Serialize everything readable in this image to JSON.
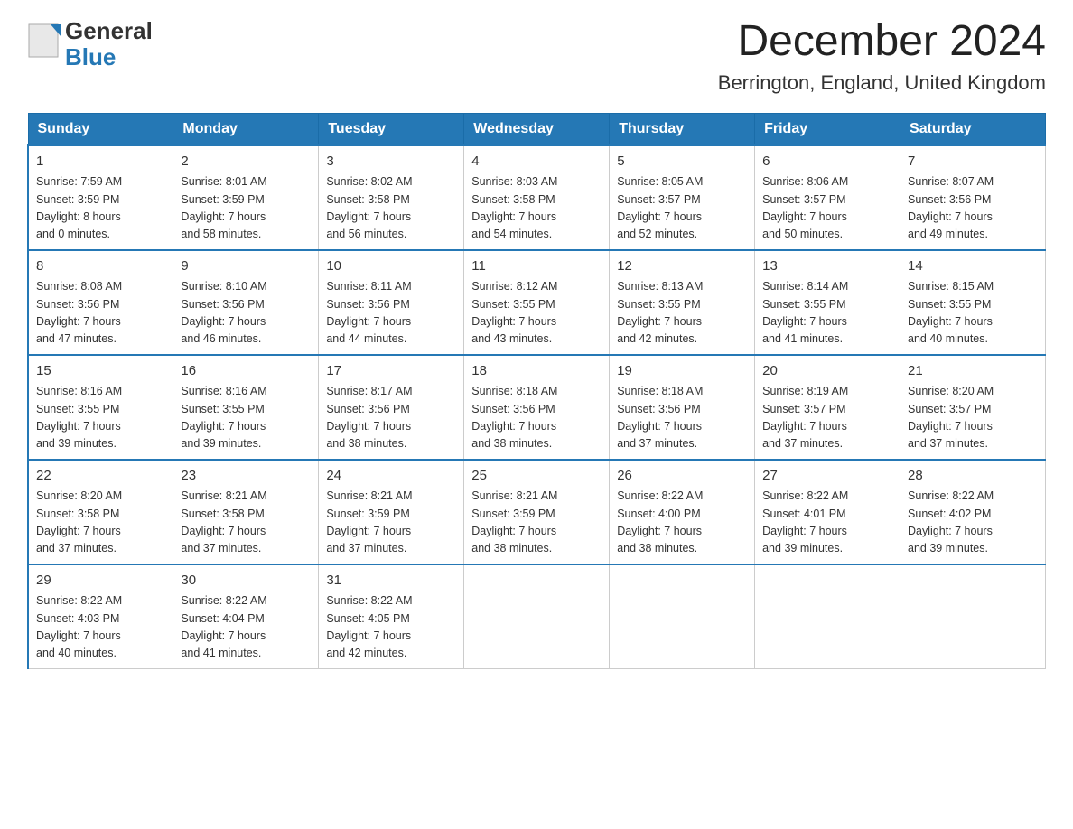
{
  "header": {
    "logo_general": "General",
    "logo_blue": "Blue",
    "month_year": "December 2024",
    "location": "Berrington, England, United Kingdom"
  },
  "days_of_week": [
    "Sunday",
    "Monday",
    "Tuesday",
    "Wednesday",
    "Thursday",
    "Friday",
    "Saturday"
  ],
  "weeks": [
    [
      {
        "day": "1",
        "sunrise": "7:59 AM",
        "sunset": "3:59 PM",
        "daylight": "8 hours and 0 minutes."
      },
      {
        "day": "2",
        "sunrise": "8:01 AM",
        "sunset": "3:59 PM",
        "daylight": "7 hours and 58 minutes."
      },
      {
        "day": "3",
        "sunrise": "8:02 AM",
        "sunset": "3:58 PM",
        "daylight": "7 hours and 56 minutes."
      },
      {
        "day": "4",
        "sunrise": "8:03 AM",
        "sunset": "3:58 PM",
        "daylight": "7 hours and 54 minutes."
      },
      {
        "day": "5",
        "sunrise": "8:05 AM",
        "sunset": "3:57 PM",
        "daylight": "7 hours and 52 minutes."
      },
      {
        "day": "6",
        "sunrise": "8:06 AM",
        "sunset": "3:57 PM",
        "daylight": "7 hours and 50 minutes."
      },
      {
        "day": "7",
        "sunrise": "8:07 AM",
        "sunset": "3:56 PM",
        "daylight": "7 hours and 49 minutes."
      }
    ],
    [
      {
        "day": "8",
        "sunrise": "8:08 AM",
        "sunset": "3:56 PM",
        "daylight": "7 hours and 47 minutes."
      },
      {
        "day": "9",
        "sunrise": "8:10 AM",
        "sunset": "3:56 PM",
        "daylight": "7 hours and 46 minutes."
      },
      {
        "day": "10",
        "sunrise": "8:11 AM",
        "sunset": "3:56 PM",
        "daylight": "7 hours and 44 minutes."
      },
      {
        "day": "11",
        "sunrise": "8:12 AM",
        "sunset": "3:55 PM",
        "daylight": "7 hours and 43 minutes."
      },
      {
        "day": "12",
        "sunrise": "8:13 AM",
        "sunset": "3:55 PM",
        "daylight": "7 hours and 42 minutes."
      },
      {
        "day": "13",
        "sunrise": "8:14 AM",
        "sunset": "3:55 PM",
        "daylight": "7 hours and 41 minutes."
      },
      {
        "day": "14",
        "sunrise": "8:15 AM",
        "sunset": "3:55 PM",
        "daylight": "7 hours and 40 minutes."
      }
    ],
    [
      {
        "day": "15",
        "sunrise": "8:16 AM",
        "sunset": "3:55 PM",
        "daylight": "7 hours and 39 minutes."
      },
      {
        "day": "16",
        "sunrise": "8:16 AM",
        "sunset": "3:55 PM",
        "daylight": "7 hours and 39 minutes."
      },
      {
        "day": "17",
        "sunrise": "8:17 AM",
        "sunset": "3:56 PM",
        "daylight": "7 hours and 38 minutes."
      },
      {
        "day": "18",
        "sunrise": "8:18 AM",
        "sunset": "3:56 PM",
        "daylight": "7 hours and 38 minutes."
      },
      {
        "day": "19",
        "sunrise": "8:18 AM",
        "sunset": "3:56 PM",
        "daylight": "7 hours and 37 minutes."
      },
      {
        "day": "20",
        "sunrise": "8:19 AM",
        "sunset": "3:57 PM",
        "daylight": "7 hours and 37 minutes."
      },
      {
        "day": "21",
        "sunrise": "8:20 AM",
        "sunset": "3:57 PM",
        "daylight": "7 hours and 37 minutes."
      }
    ],
    [
      {
        "day": "22",
        "sunrise": "8:20 AM",
        "sunset": "3:58 PM",
        "daylight": "7 hours and 37 minutes."
      },
      {
        "day": "23",
        "sunrise": "8:21 AM",
        "sunset": "3:58 PM",
        "daylight": "7 hours and 37 minutes."
      },
      {
        "day": "24",
        "sunrise": "8:21 AM",
        "sunset": "3:59 PM",
        "daylight": "7 hours and 37 minutes."
      },
      {
        "day": "25",
        "sunrise": "8:21 AM",
        "sunset": "3:59 PM",
        "daylight": "7 hours and 38 minutes."
      },
      {
        "day": "26",
        "sunrise": "8:22 AM",
        "sunset": "4:00 PM",
        "daylight": "7 hours and 38 minutes."
      },
      {
        "day": "27",
        "sunrise": "8:22 AM",
        "sunset": "4:01 PM",
        "daylight": "7 hours and 39 minutes."
      },
      {
        "day": "28",
        "sunrise": "8:22 AM",
        "sunset": "4:02 PM",
        "daylight": "7 hours and 39 minutes."
      }
    ],
    [
      {
        "day": "29",
        "sunrise": "8:22 AM",
        "sunset": "4:03 PM",
        "daylight": "7 hours and 40 minutes."
      },
      {
        "day": "30",
        "sunrise": "8:22 AM",
        "sunset": "4:04 PM",
        "daylight": "7 hours and 41 minutes."
      },
      {
        "day": "31",
        "sunrise": "8:22 AM",
        "sunset": "4:05 PM",
        "daylight": "7 hours and 42 minutes."
      },
      null,
      null,
      null,
      null
    ]
  ],
  "labels": {
    "sunrise": "Sunrise:",
    "sunset": "Sunset:",
    "daylight": "Daylight:"
  }
}
